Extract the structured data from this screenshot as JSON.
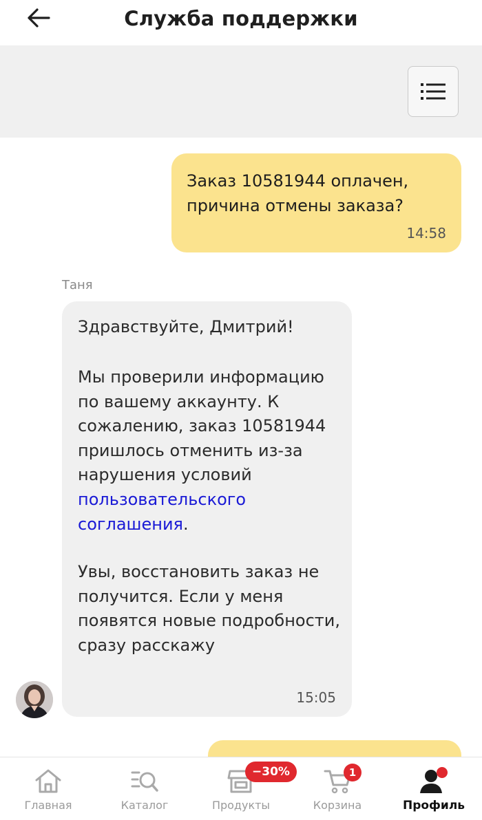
{
  "header": {
    "title": "Служба поддержки",
    "back_icon": "arrow-left-icon"
  },
  "toolbar": {
    "menu_icon": "list-icon"
  },
  "messages": [
    {
      "direction": "outgoing",
      "text": "Заказ 10581944 оплачен, причина отмены заказа?",
      "time": "14:58"
    },
    {
      "direction": "incoming",
      "sender": "Таня",
      "greeting": "Здравствуйте, Дмитрий!",
      "body_before_link": "Мы проверили информацию по вашему аккаунту. К сожалению, заказ 10581944 пришлось отменить из-за нарушения условий ",
      "link_text": "пользовательского соглашения",
      "body_after_link": ".",
      "closing": "Увы, восстановить заказ не получится. Если у меня появятся новые подробности, сразу расскажу",
      "time": "15:05"
    }
  ],
  "colors": {
    "outgoing_bubble": "#fbe38e",
    "incoming_bubble": "#f0f0f0",
    "link": "#1a1ad6",
    "badge": "#e0282e"
  },
  "bottom_nav": {
    "items": [
      {
        "label": "Главная",
        "icon": "home-icon",
        "active": false
      },
      {
        "label": "Каталог",
        "icon": "catalog-search-icon",
        "active": false
      },
      {
        "label": "Продукты",
        "icon": "shop-icon",
        "active": false,
        "badge": "−30%"
      },
      {
        "label": "Корзина",
        "icon": "cart-icon",
        "active": false,
        "badge": "1"
      },
      {
        "label": "Профиль",
        "icon": "profile-icon",
        "active": true
      }
    ]
  }
}
